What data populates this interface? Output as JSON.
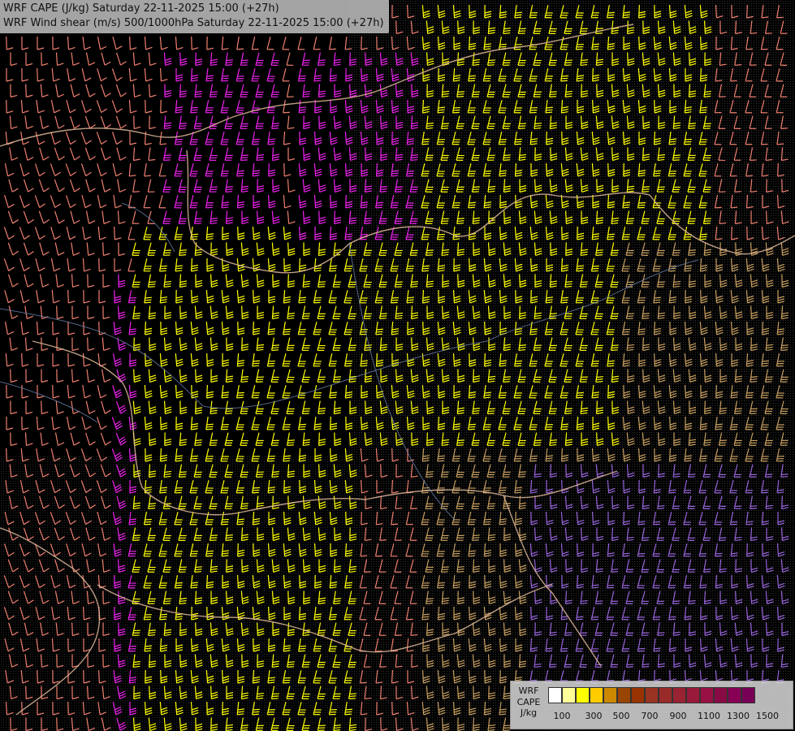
{
  "header": {
    "line1": "WRF CAPE (J/kg) Saturday 22-11-2025 15:00 (+27h)",
    "line2": "WRF Wind shear (m/s) 500/1000hPa Saturday 22-11-2025 15:00 (+27h)"
  },
  "legend": {
    "title_lines": [
      "WRF",
      "CAPE",
      "J/kg"
    ],
    "colors": [
      "#ffffff",
      "#ffff99",
      "#ffff00",
      "#ffcc00",
      "#cc8800",
      "#994400",
      "#993300",
      "#993322",
      "#992a2a",
      "#992233",
      "#991a3a",
      "#991144",
      "#880a44",
      "#880055",
      "#770055"
    ],
    "tick_labels": [
      "100",
      "300",
      "500",
      "700",
      "900",
      "1100",
      "1300",
      "1500"
    ]
  },
  "barb_colors": {
    "salmon": "#f08070",
    "magenta": "#ee22ee",
    "yellow": "#ffff00",
    "tan": "#c8a060",
    "violet": "#9966dd",
    "border": "#e0b89a",
    "coast": "#8899bb"
  }
}
